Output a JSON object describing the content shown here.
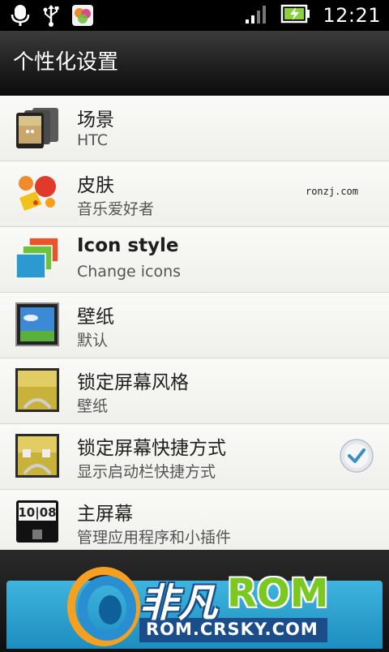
{
  "status_bar": {
    "time": "12:21",
    "icons": [
      "microphone-icon",
      "usb-icon",
      "app-notification-icon",
      "signal-icon",
      "battery-charging-icon"
    ]
  },
  "header": {
    "title": "个性化设置"
  },
  "list": {
    "items": [
      {
        "icon": "scenes-icon",
        "title": "场景",
        "subtitle": "HTC",
        "title_bold": false
      },
      {
        "icon": "skin-icon",
        "title": "皮肤",
        "subtitle": "音乐爱好者",
        "title_bold": false,
        "watermark": "ronzj.com"
      },
      {
        "icon": "icon-style-icon",
        "title": "Icon style",
        "subtitle": "Change icons",
        "title_bold": true
      },
      {
        "icon": "wallpaper-icon",
        "title": "壁纸",
        "subtitle": "默认",
        "title_bold": false
      },
      {
        "icon": "lockscreen-style-icon",
        "title": "锁定屏幕风格",
        "subtitle": "壁纸",
        "title_bold": false
      },
      {
        "icon": "lockscreen-shortcuts-icon",
        "title": "锁定屏幕快捷方式",
        "subtitle": "显示启动栏快捷方式",
        "title_bold": false,
        "checked": true
      },
      {
        "icon": "home-screen-icon",
        "title": "主屏幕",
        "subtitle": "管理应用程序和小插件",
        "title_bold": false
      }
    ]
  },
  "logo": {
    "text_cn": "非凡",
    "text_rom": "ROM",
    "url_text": "ROM.CRSKY.COM"
  },
  "colors": {
    "accent_blue": "#2aa0d0",
    "logo_green": "#7ac820",
    "check_blue": "#3a8fc0"
  }
}
